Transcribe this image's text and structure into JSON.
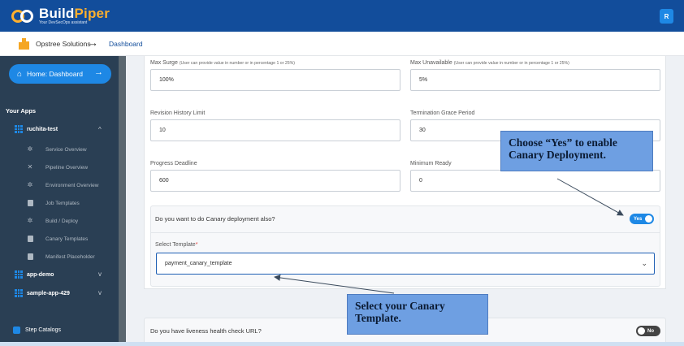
{
  "header": {
    "brand_main": "Build",
    "brand_accent": "Piper",
    "tagline": "Your DevSecOps assistant",
    "avatar_initial": "R"
  },
  "breadcrumb": {
    "org": "Opstree Solutions",
    "separator": "→",
    "current": "Dashboard"
  },
  "sidebar": {
    "home_label": "Home: Dashboard",
    "home_arrow": "→",
    "section_title": "Your Apps",
    "apps": [
      {
        "name": "ruchita-test",
        "expanded": true,
        "chevron": "^"
      },
      {
        "name": "app-demo",
        "chevron": "v"
      },
      {
        "name": "sample-app-429",
        "chevron": "v"
      }
    ],
    "sub_items": [
      {
        "label": "Service Overview",
        "icon": "gear-icon"
      },
      {
        "label": "Pipeline Overview",
        "icon": "wrench-icon"
      },
      {
        "label": "Environment Overview",
        "icon": "gear-icon"
      },
      {
        "label": "Job Templates",
        "icon": "document-icon"
      },
      {
        "label": "Build / Deploy",
        "icon": "gear-icon"
      },
      {
        "label": "Canary Templates",
        "icon": "document-icon"
      },
      {
        "label": "Manifest Placeholder",
        "icon": "document-icon"
      }
    ],
    "footer": "Step Catalogs"
  },
  "form": {
    "max_surge": {
      "label": "Max Surge",
      "hint": "(User can provide value in number or in percentage 1 or 25%)",
      "value": "100%"
    },
    "max_unavailable": {
      "label": "Max Unavailable",
      "hint": "(User can provide value in number or in percentage 1 or 25%)",
      "value": "5%"
    },
    "revision_history_limit": {
      "label": "Revision History Limit",
      "value": "10"
    },
    "termination_grace_period": {
      "label": "Termination Grace Period",
      "value": "30"
    },
    "progress_deadline": {
      "label": "Progress Deadline",
      "value": "600"
    },
    "minimum_ready": {
      "label": "Minimum Ready",
      "value": "0"
    },
    "canary": {
      "question": "Do you want to do Canary deployment also?",
      "toggle_label": "Yes",
      "select_label": "Select Template",
      "required_mark": "*",
      "selected_template": "payment_canary_template",
      "chevron": "⌄"
    },
    "liveness": {
      "question": "Do you have liveness health check URL?",
      "toggle_label": "No"
    }
  },
  "callouts": {
    "canary_toggle": [
      "Choose “Yes” to enable",
      "Canary Deployment."
    ],
    "template": [
      "Select your Canary",
      "Template."
    ]
  },
  "colors": {
    "primary": "#124d9b",
    "accent": "#1e88e5",
    "logo_accent": "#ffb02e",
    "sidebar": "#2a3f54",
    "callout": "#6e9fe2"
  }
}
